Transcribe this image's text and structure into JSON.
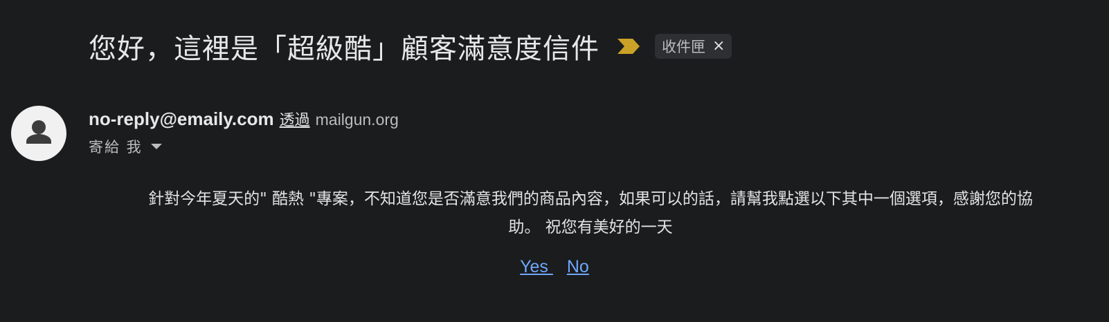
{
  "email": {
    "subject": "您好，這裡是「超級酷」顧客滿意度信件",
    "importance_icon": "importance-marker-icon",
    "label_chip": {
      "label": "收件匣",
      "close_glyph": "×"
    },
    "sender": {
      "email": "no-reply@emaily.com",
      "via_label": "透過",
      "via_domain": "mailgun.org",
      "avatar_icon": "person-icon"
    },
    "recipient": {
      "label": "寄給 我"
    },
    "body": {
      "line1": "針對今年夏天的\" 酷熱 \"專案，不知道您是否滿意我們的商品內容，如果可以的話，請幫我點選以下其中一個選項，感謝您的協",
      "line2": "助。 祝您有美好的一天"
    },
    "options": {
      "yes": "Yes ",
      "no": "No"
    },
    "colors": {
      "background": "#1b1c1e",
      "link": "#6ea8fe",
      "importance": "#c9a227"
    }
  }
}
